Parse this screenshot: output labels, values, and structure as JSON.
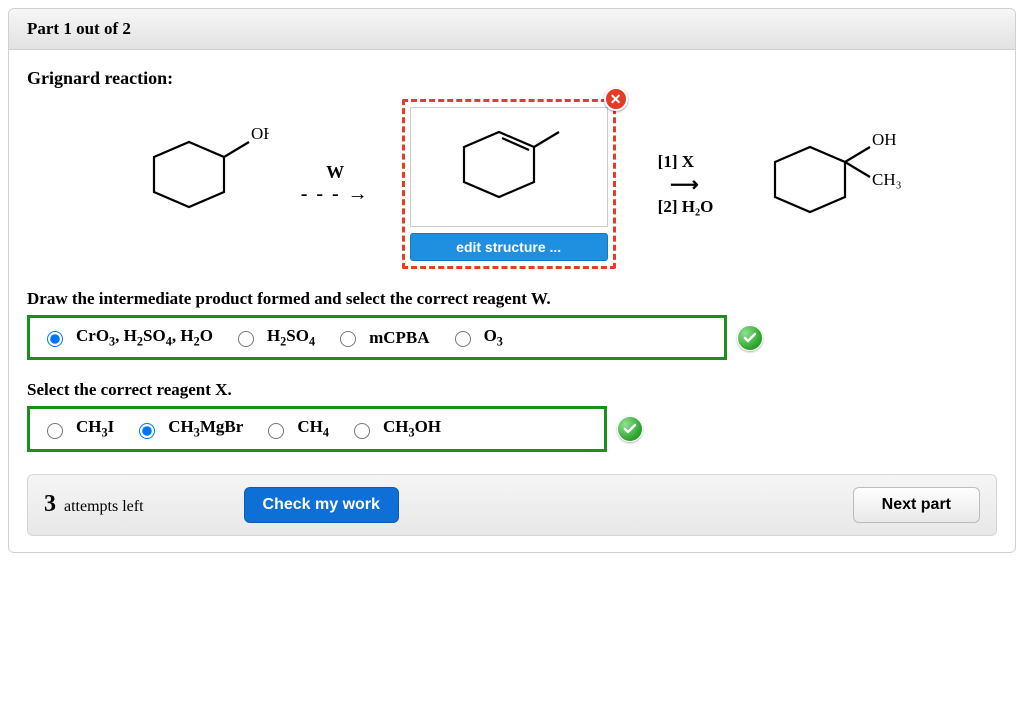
{
  "part_header": "Part 1 out of 2",
  "title": "Grignard reaction:",
  "reagent_W_label": "W",
  "arrow_glyph": "⟶",
  "dashed_arrow_glyph": "- - - →",
  "reagent_step1_prefix": "[1] ",
  "reagent_step1_var": "X",
  "reagent_step2": "[2] H₂O",
  "edit_btn": "edit structure ...",
  "close_glyph": "✕",
  "starting_OH": "OH",
  "product_OH": "OH",
  "product_CH3": "CH₃",
  "prompt_W": "Draw the intermediate product formed and select the correct reagent W.",
  "optionsW": [
    {
      "label_html": "CrO<sub>3</sub>, H<sub>2</sub>SO<sub>4</sub>, H<sub>2</sub>O",
      "selected": true
    },
    {
      "label_html": "H<sub>2</sub>SO<sub>4</sub>",
      "selected": false
    },
    {
      "label_html": "mCPBA",
      "selected": false
    },
    {
      "label_html": "O<sub>3</sub>",
      "selected": false
    }
  ],
  "prompt_X": "Select the correct reagent X.",
  "optionsX": [
    {
      "label_html": "CH<sub>3</sub>I",
      "selected": false
    },
    {
      "label_html": "CH<sub>3</sub>MgBr",
      "selected": true
    },
    {
      "label_html": "CH<sub>4</sub>",
      "selected": false
    },
    {
      "label_html": "CH<sub>3</sub>OH",
      "selected": false
    }
  ],
  "attempts_num": "3",
  "attempts_text": "attempts left",
  "check_btn": "Check my work",
  "next_btn": "Next part"
}
